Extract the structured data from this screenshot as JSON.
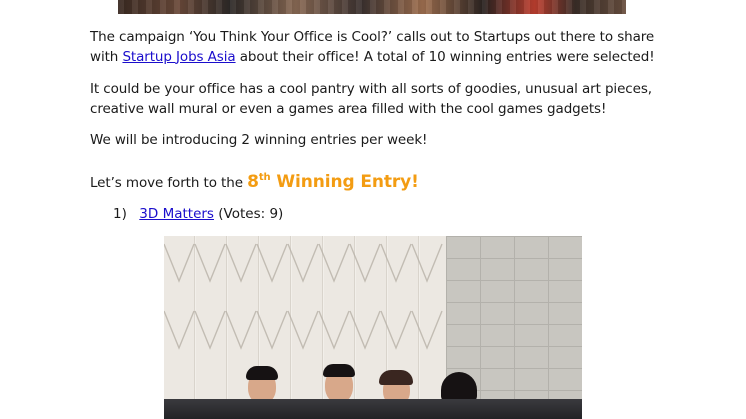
{
  "paragraphs": {
    "p1_before": "The campaign ‘You Think Your Office is Cool?’ calls out to Startups out there to share with ",
    "p1_link": "Startup Jobs Asia",
    "p1_after": " about their office! A total of 10 winning entries were selected!",
    "p2": "It could be your office has a cool pantry with all sorts of goodies, unusual art pieces, creative wall mural or even a games area filled with the cool games gadgets!",
    "p3": "We will be introducing 2 winning entries per week!",
    "p4_before": "Let’s move forth to the ",
    "p4_number": "8",
    "p4_suffix": "th",
    "p4_highlight": " Winning Entry!"
  },
  "list": {
    "number": "1)",
    "link": "3D Matters",
    "votes": " (Votes: 9)"
  },
  "colors": {
    "highlight": "#f39c12",
    "link": "#1a0dcc"
  }
}
